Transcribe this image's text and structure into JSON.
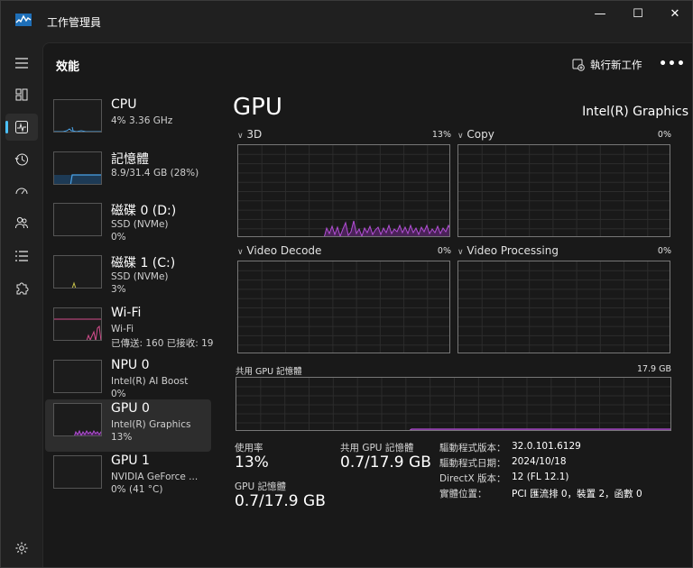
{
  "window": {
    "title": "工作管理員",
    "minimize": "—",
    "maximize": "☐",
    "close": "✕"
  },
  "header": {
    "title": "效能",
    "run_new_task": "執行新工作",
    "more": "•••"
  },
  "processes": [
    {
      "name": "CPU",
      "line1": "4% 3.36 GHz",
      "line2": "",
      "color": "#4aa3e8"
    },
    {
      "name": "記憶體",
      "line1": "8.9/31.4 GB (28%)",
      "line2": "",
      "color": "#4aa3e8"
    },
    {
      "name": "磁碟 0 (D:)",
      "line1": "SSD (NVMe)",
      "line2": "0%",
      "color": "#9fc26c"
    },
    {
      "name": "磁碟 1 (C:)",
      "line1": "SSD (NVMe)",
      "line2": "3%",
      "color": "#c8c34a"
    },
    {
      "name": "Wi-Fi",
      "line1": "Wi-Fi",
      "line2": "已傳送: 160 已接收: 19",
      "color": "#d44d8d"
    },
    {
      "name": "NPU 0",
      "line1": "Intel(R) AI Boost",
      "line2": "0%",
      "color": "#4aa3e8"
    },
    {
      "name": "GPU 0",
      "line1": "Intel(R) Graphics",
      "line2": "13%",
      "color": "#b34fd6"
    },
    {
      "name": "GPU 1",
      "line1": "NVIDIA GeForce ...",
      "line2": "0% (41 °C)",
      "color": "#b34fd6"
    }
  ],
  "detail": {
    "title": "GPU",
    "model": "Intel(R) Graphics",
    "engines": [
      {
        "label": "3D",
        "percent": "13%"
      },
      {
        "label": "Copy",
        "percent": "0%"
      },
      {
        "label": "Video Decode",
        "percent": "0%"
      },
      {
        "label": "Video Processing",
        "percent": "0%"
      }
    ],
    "shared_memory": {
      "label": "共用 GPU 記憶體",
      "max": "17.9 GB"
    },
    "stats": {
      "utilization_label": "使用率",
      "utilization_value": "13%",
      "shared_mem_label": "共用 GPU 記憶體",
      "shared_mem_value": "0.7/17.9 GB",
      "gpu_mem_label": "GPU 記憶體",
      "gpu_mem_value": "0.7/17.9 GB"
    },
    "info": [
      {
        "key": "驅動程式版本：",
        "value": "32.0.101.6129"
      },
      {
        "key": "驅動程式日期：",
        "value": "2024/10/18"
      },
      {
        "key": "DirectX 版本：",
        "value": "12 (FL 12.1)"
      },
      {
        "key": "實體位置：",
        "value": "PCI 匯流排 0，裝置 2，函數 0"
      }
    ]
  },
  "colors": {
    "accent": "#4cc2ff",
    "gpu": "#b34fd6",
    "gpu_fill": "#4a2258"
  }
}
